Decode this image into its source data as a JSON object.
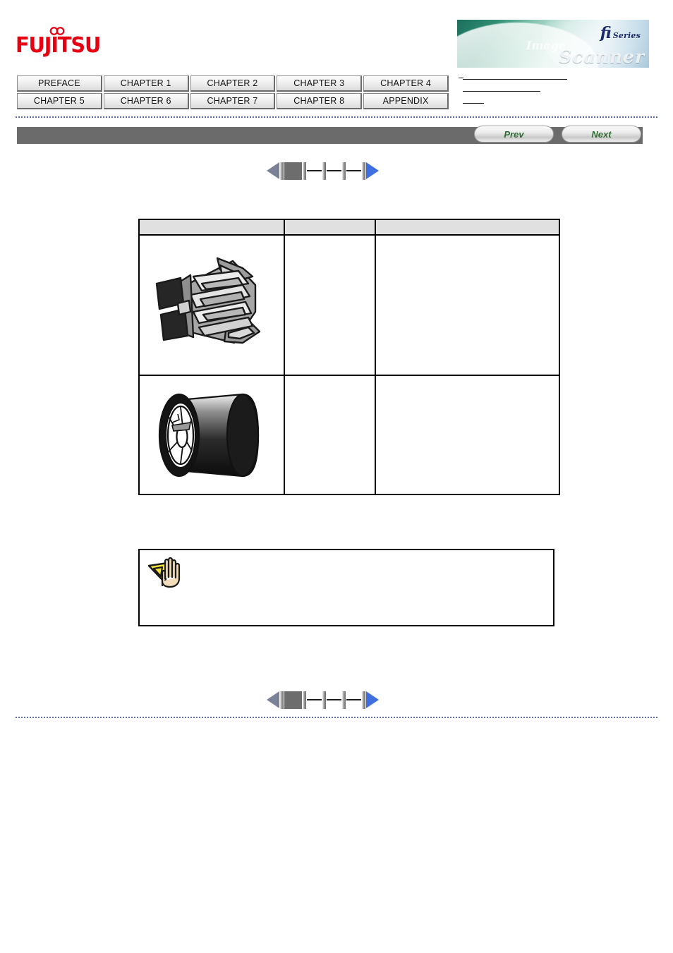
{
  "brand": {
    "logo_text": "FUJITSU",
    "logo_mark_name": "fujitsu-infinity-mark"
  },
  "product_banner": {
    "series_mark": "fi",
    "series_word": "Series",
    "script_small": "Image",
    "script_large": "Scanner"
  },
  "chapter_nav": {
    "row1": [
      {
        "label": "PREFACE"
      },
      {
        "label": "CHAPTER 1"
      },
      {
        "label": "CHAPTER 2"
      },
      {
        "label": "CHAPTER 3"
      },
      {
        "label": "CHAPTER 4"
      }
    ],
    "row2": [
      {
        "label": "CHAPTER 5"
      },
      {
        "label": "CHAPTER 6"
      },
      {
        "label": "CHAPTER 7"
      },
      {
        "label": "CHAPTER 8"
      },
      {
        "label": "APPENDIX"
      }
    ]
  },
  "toolbar": {
    "prev_label": "Prev",
    "next_label": "Next",
    "background_color": "#6b6b6b"
  },
  "page_stepper": {
    "prev_arrow_name": "step-prev-arrow",
    "next_arrow_name": "step-next-arrow",
    "prev_arrow_color": "#7b8196",
    "next_arrow_color": "#3f6fe0",
    "current_step": 1,
    "total_steps": 4,
    "steps": [
      {
        "state": "current"
      },
      {
        "state": "available"
      },
      {
        "state": "available"
      },
      {
        "state": "available"
      }
    ]
  },
  "parts_table": {
    "headers": [
      "",
      "",
      ""
    ],
    "rows": [
      {
        "image_name": "pad-assembly-figure",
        "quantity": "",
        "description": ""
      },
      {
        "image_name": "pick-roller-figure",
        "quantity": "",
        "description": ""
      }
    ]
  },
  "attention_note": {
    "icon_name": "attention-hand-icon",
    "text": ""
  },
  "colors": {
    "brand_red": "#e60012",
    "table_header_gray": "#e0e0e0",
    "dotted_rule_blue": "#5a6fb0",
    "button_text_green": "#2f6b35"
  }
}
